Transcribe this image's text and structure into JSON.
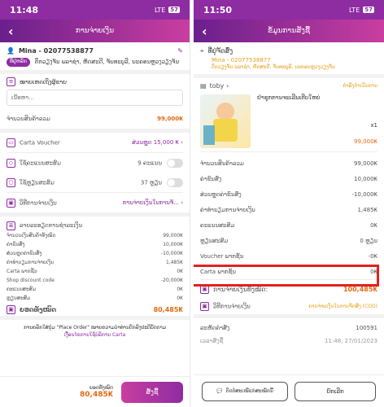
{
  "left": {
    "status_time": "11:48",
    "network": "LTE",
    "battery": "57",
    "header_title": "ການຈ່າຍເງິນ",
    "customer_name": "Mina - 02077538877",
    "address_tag": "ທີ່ຢູ່ຫລັກ",
    "address": "ຕຶກວຽງຈັນ ພລາຊ່າ, ຫັດສະດີ, ຈັນທະບູລີ, ນະຄອນຫຼວງວຽງຈັນ",
    "note_label": "ໝາຍເຫດເຖິງຜູ້ຂາຍ",
    "note_placeholder": "ເນື້ອຫາ...",
    "subtotal_label": "ຈຳນວນສິນຄ້າລວມ",
    "subtotal_value": "99,000₭",
    "voucher_label": "Carta Voucher",
    "voucher_value": "ສ່ວນຫຼຸດ 15,000 ₭",
    "points_label": "ໃຊ້ຄະແນນສະສົມ",
    "points_value": "9 ຄະແນນ",
    "coins_label": "ໃຊ້ຫຼຽນສະສົມ",
    "coins_value": "37 ຫຼຽນ",
    "payment_label": "ວິທີການຈ່າຍເງິນ",
    "payment_value": "ການຈ່າຍເງິນໃນການຈັ...",
    "summary_title": "ລາຍລະອຽດການຊຳລະເງິນ",
    "summary_rows": [
      {
        "label": "ຈຳນວນເງິນສິນຄ້າທັງໝົດ",
        "value": "99,000₭"
      },
      {
        "label": "ຄ່າຂົນສົ່ງ",
        "value": "10,000₭"
      },
      {
        "label": "ສ່ວນຫຼຸດຄ່າຂົນສົ່ງ",
        "value": "-10,000₭"
      },
      {
        "label": "ຄ່າທຳນຽມການຈ່າຍເງິນ",
        "value": "1,485₭"
      },
      {
        "label": "Carta ພາກຊັ້ນ",
        "value": "0₭"
      },
      {
        "label": "Shop discount code",
        "value": "-20,000₭"
      },
      {
        "label": "ຄະແນນສະສົມ",
        "value": "0₭"
      },
      {
        "label": "ຫຼຽນສະສົມ",
        "value": "0₭"
      }
    ],
    "total_label": "ຍອດທັງໝົດ",
    "total_value": "80,485₭",
    "footnote": "ການຄລິກໃສ່ປຸ່ມ \"Place Order\" ໝາຍຄວາມວ່າທ່ານຕົກລົງປະຕິບັດຕາມ",
    "footnote_link": "ເງື່ອນໄຂການໃຊ້ບໍລິການ Carta",
    "bottom_total_label": "ຍອດທັງໝົດ",
    "bottom_total_value": "80,485₭",
    "order_button": "ສັ່ງຊື້"
  },
  "right": {
    "status_time": "11:50",
    "network": "LTE",
    "battery": "57",
    "header_title": "ຂໍ້ມູນການສັ່ງຊື້",
    "address_title": "ທີ່ຢູ່ຈັດສົ່ງ",
    "customer_name": "Mina - 02077538877",
    "address": "ຕຶກວຽງຈັນ ພລາຊ່າ, ຫັດສະດີ, ຈັນທະບູລີ, ນະຄອນຫຼວງວຽງຈັນ",
    "shop_name": "toby",
    "shop_status": "ກຳລັງດຳເນີນການ",
    "product_name": "ຢ່າຊຸກການຈະເລີນເຕີບໃຫຍ່",
    "product_qty": "x1",
    "product_price": "99,000₭",
    "summary_rows": [
      {
        "label": "ຈຳນວນສິນຄ້າລວມ",
        "value": "99,000₭"
      },
      {
        "label": "ຄ່າຂົນສົ່ງ",
        "value": "10,000₭"
      },
      {
        "label": "ສ່ວນຫຼຸດຄ່າຂົນສົ່ງ",
        "value": "-10,000₭"
      },
      {
        "label": "ຄ່າທຳນຽມການຈ່າຍເງິນ",
        "value": "1,485₭"
      },
      {
        "label": "ຄະແນນສະສົມ",
        "value": "0₭"
      },
      {
        "label": "ຫຼຽນສະສົມ",
        "value": "0 ຫຼຽນ"
      },
      {
        "label": "Voucher ພາກຊັ້ນ",
        "value": "-0₭"
      },
      {
        "label": "Carta ພາກຊັ້ນ",
        "value": "0₭"
      }
    ],
    "total_label": "ການຈ່າຍເງິນທັງໝົດ:",
    "total_value": "100,485₭",
    "payment_label": "ວິທີການຈ່າຍເງິນ",
    "payment_value": "ການຈ່າຍເງິນໃນການຈັດສົ່ງ (COD)",
    "order_id_label": "ລະຫັດຄຳສັ່ງ",
    "order_id_value": "100591",
    "order_time_label": "ເວລາສັ່ງຊື້",
    "order_time_value": "11:48, 27/01/2023",
    "contact_button": "ຕິດຕໍ່ສະເໜີແກ່ສະໝັກນີ້",
    "cancel_button": "ຍົກເລີກ",
    "accent": "#8e2ca2",
    "highlight_color": "#e0221f"
  }
}
